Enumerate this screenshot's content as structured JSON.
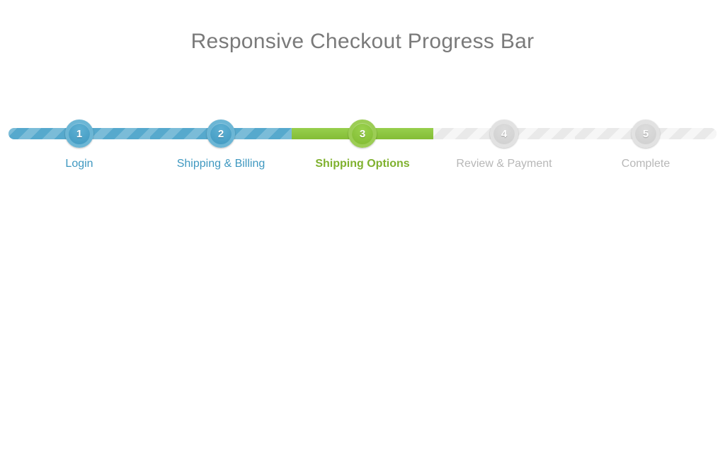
{
  "title": "Responsive Checkout Progress Bar",
  "current_step_index": 2,
  "steps": [
    {
      "number": "1",
      "label": "Login",
      "state": "done"
    },
    {
      "number": "2",
      "label": "Shipping & Billing",
      "state": "done"
    },
    {
      "number": "3",
      "label": "Shipping Options",
      "state": "current"
    },
    {
      "number": "4",
      "label": "Review & Payment",
      "state": "todo"
    },
    {
      "number": "5",
      "label": "Complete",
      "state": "todo"
    }
  ],
  "colors": {
    "done": "#4ba1c7",
    "current": "#8dc63f",
    "todo": "#d7d7d7",
    "title": "#7a7a7a"
  }
}
